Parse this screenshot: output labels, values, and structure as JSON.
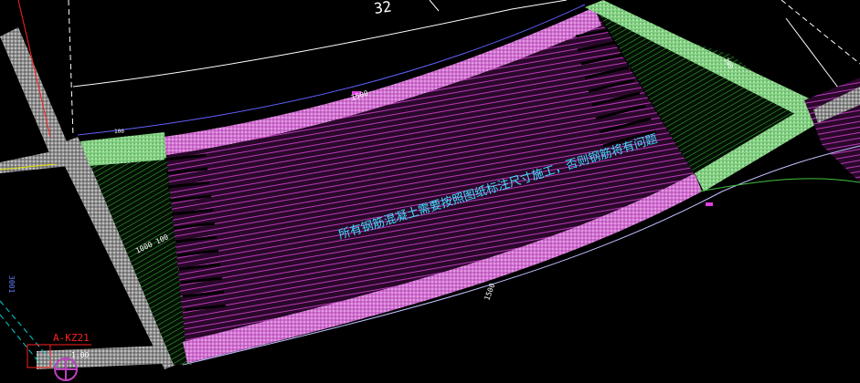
{
  "labels": {
    "top_number": "32",
    "main_note": "所有钢筋混凝土需要按照图纸标注尺寸施工，否则钢筋将有问题",
    "grid_label": "A-KZ21",
    "dim_left_diagonal": "1000 100",
    "dim_top_edge": "1500",
    "dim_bottom_edge": "1500",
    "dim_small_top_left": "100",
    "dim_right_edge": "100",
    "dim_bottom_small": "1.00",
    "dim_left_vertical": "3001"
  },
  "colors": {
    "background": "#000000",
    "slab_fill": "#3a0a3a",
    "hatch_magenta": "#c040c0",
    "hatch_pink": "#e080e0",
    "beam_border": "#f0a0f0",
    "green_hatch": "#40c040",
    "green_band": "#90e090",
    "gray_wall": "#a0a0a0",
    "note_text": "#40e0ff",
    "white_line": "#ffffff",
    "red_line": "#ff2020",
    "cyan_line": "#00d0d0",
    "yellow_line": "#e0e000"
  }
}
